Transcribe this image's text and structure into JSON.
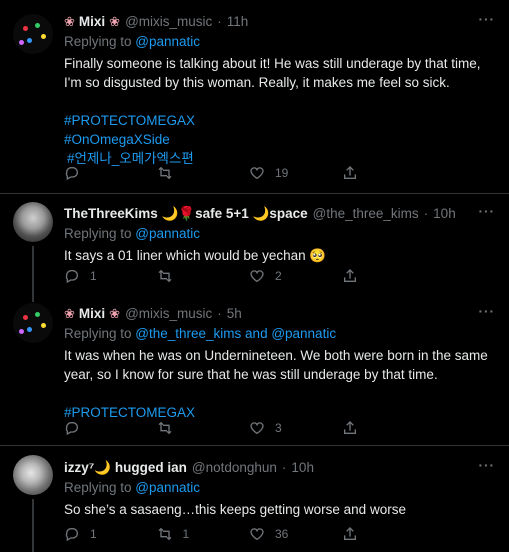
{
  "tweets": [
    {
      "display_name": "Mixi",
      "flower_left": "❀",
      "flower_right": "❀",
      "handle": "@mixis_music",
      "time": "11h",
      "replying_prefix": "Replying to ",
      "replying_to": "@pannatic",
      "text": "Finally someone is talking about it! He was still underage by that time, I'm so disgusted by this woman. Really, it makes me feel so sick.",
      "hashtags": [
        "#PROTECTOMEGAX",
        "#OnOmegaXSide",
        "#언제나_오메가엑스편"
      ],
      "replies": "",
      "retweets": "",
      "likes": "19"
    },
    {
      "display_name": "TheThreeKims 🌙🌹safe 5+1 🌙space",
      "handle": "@the_three_kims",
      "time": "10h",
      "replying_prefix": "Replying to ",
      "replying_to": "@pannatic",
      "text": "It says a 01 liner which would be yechan 🥺",
      "replies": "1",
      "retweets": "",
      "likes": "2"
    },
    {
      "display_name": "Mixi",
      "flower_left": "❀",
      "flower_right": "❀",
      "handle": "@mixis_music",
      "time": "5h",
      "replying_prefix": "Replying to ",
      "replying_to": "@the_three_kims and @pannatic",
      "text": "It was when he was on Undernineteen. We both were born in the same year, so I know for sure that he was still underage by that time.",
      "hashtags": [
        "#PROTECTOMEGAX"
      ],
      "replies": "",
      "retweets": "",
      "likes": "3"
    },
    {
      "display_name": "izzy⁷🌙 hugged ian",
      "handle": "@notdonghun",
      "time": "10h",
      "replying_prefix": "Replying to ",
      "replying_to": "@pannatic",
      "text": "So she’s a sasaeng…this keeps getting worse and worse",
      "replies": "1",
      "retweets": "1",
      "likes": "36"
    }
  ],
  "separator": "·",
  "more_label": "···"
}
